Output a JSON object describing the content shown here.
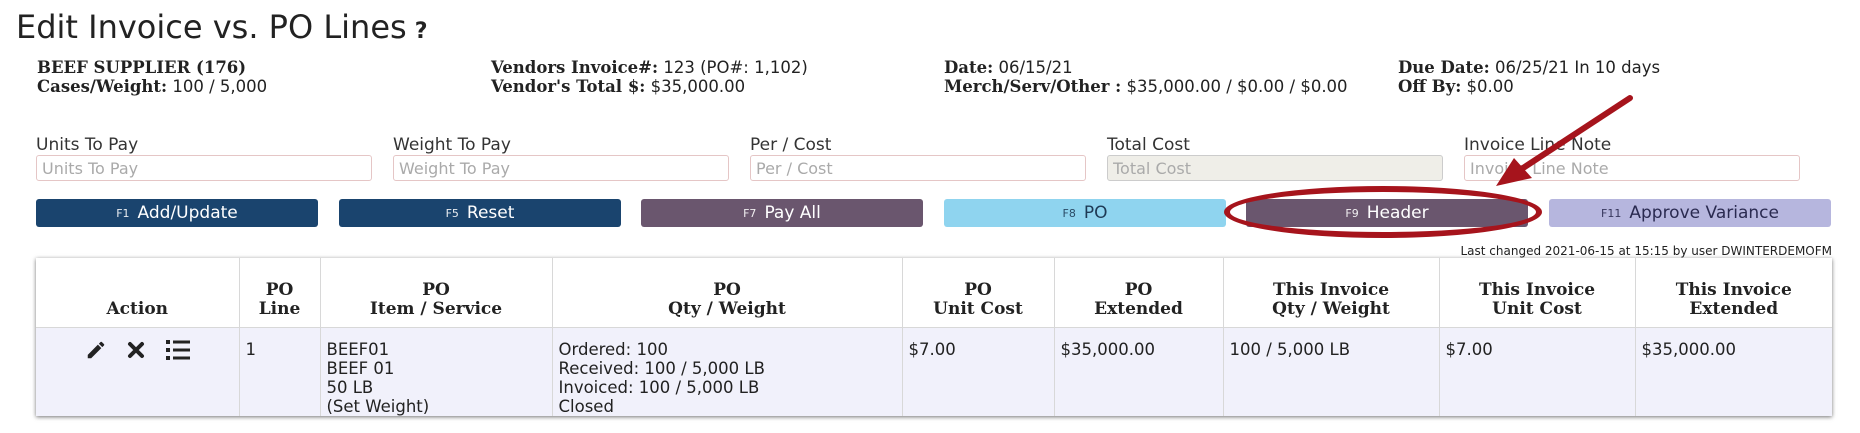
{
  "page": {
    "title": "Edit Invoice vs. PO Lines",
    "help": "?"
  },
  "info": {
    "vendor_name": "BEEF SUPPLIER (176)",
    "cases_weight_label": "Cases/Weight:",
    "cases_weight_value": "100 / 5,000",
    "vendors_invoice_label": "Vendors Invoice#:",
    "vendors_invoice_value": "123 (PO#: 1,102)",
    "vendors_total_label": "Vendor's Total $:",
    "vendors_total_value": "$35,000.00",
    "date_label": "Date:",
    "date_value": "06/15/21",
    "merch_label": "Merch/Serv/Other :",
    "merch_value": "$35,000.00 / $0.00 / $0.00",
    "due_date_label": "Due Date:",
    "due_date_value": "06/25/21 In 10 days",
    "off_by_label": "Off By:",
    "off_by_value": "$0.00"
  },
  "form": {
    "units_label": "Units To Pay",
    "units_placeholder": "Units To Pay",
    "weight_label": "Weight To Pay",
    "weight_placeholder": "Weight To Pay",
    "per_label": "Per / Cost",
    "per_placeholder": "Per / Cost",
    "total_label": "Total Cost",
    "total_placeholder": "Total Cost",
    "note_label": "Invoice Line Note",
    "note_placeholder": "Invoice Line Note"
  },
  "buttons": {
    "add": {
      "key": "F1",
      "label": "Add/Update"
    },
    "reset": {
      "key": "F5",
      "label": "Reset"
    },
    "payall": {
      "key": "F7",
      "label": "Pay All"
    },
    "po": {
      "key": "F8",
      "label": "PO"
    },
    "header": {
      "key": "F9",
      "label": "Header"
    },
    "approve": {
      "key": "F11",
      "label": "Approve Variance"
    }
  },
  "last_changed": "Last changed 2021-06-15 at 15:15 by user DWINTERDEMOFM",
  "table": {
    "headers": [
      [
        "",
        "Action"
      ],
      [
        "PO",
        "Line"
      ],
      [
        "PO",
        "Item / Service"
      ],
      [
        "PO",
        "Qty / Weight"
      ],
      [
        "PO",
        "Unit Cost"
      ],
      [
        "PO",
        "Extended"
      ],
      [
        "This Invoice",
        "Qty / Weight"
      ],
      [
        "This Invoice",
        "Unit Cost"
      ],
      [
        "This Invoice",
        "Extended"
      ]
    ],
    "rows": [
      {
        "line": "1",
        "item": [
          "BEEF01",
          "BEEF 01",
          "50 LB",
          "(Set Weight)"
        ],
        "po_qty": [
          "Ordered: 100",
          "Received: 100 / 5,000 LB",
          "Invoiced: 100 / 5,000 LB",
          "Closed"
        ],
        "po_unit_cost": "$7.00",
        "po_extended": "$35,000.00",
        "inv_qty": "100 / 5,000 LB",
        "inv_unit_cost": "$7.00",
        "inv_extended": "$35,000.00"
      }
    ]
  },
  "annotation_color": "#a6141c"
}
